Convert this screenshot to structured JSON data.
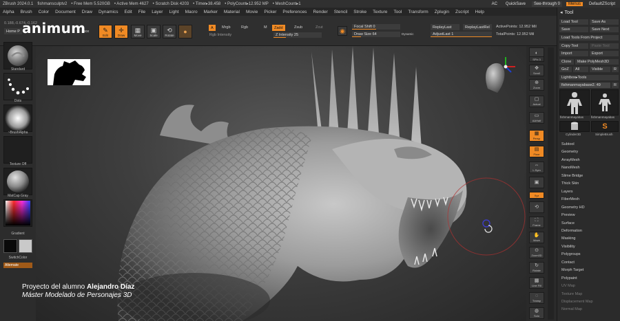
{
  "titlebar": {
    "app_version": "ZBrush 2024.0.1",
    "project": "fishmansculptv2",
    "free_mem": "• Free Mem 5.520GB",
    "active_mem": "• Active Mem 4627",
    "scratch_disk": "• Scratch Disk 4203",
    "timer": "• Timer▸38.458",
    "poly_count": "• PolyCount▸12.952 MP",
    "mesh_count": "• MeshCount▸1",
    "ac": "AC",
    "quicksave": "QuickSave",
    "see_through": "See-through  0",
    "menus": "Menus",
    "default_script": "DefaultZScript"
  },
  "menubar": [
    "Alpha",
    "Brush",
    "Color",
    "Document",
    "Draw",
    "Dynamics",
    "Edit",
    "File",
    "Layer",
    "Light",
    "Macro",
    "Marker",
    "Material",
    "Movie",
    "Picker",
    "Preferences",
    "Render",
    "Stencil",
    "Stroke",
    "Texture",
    "Tool",
    "Transform",
    "Zplugin",
    "Zscript",
    "Help"
  ],
  "topshelf": {
    "home": "Home P",
    "lightbox_partial": "tbox",
    "coord": "0.188,-0.674,-0.162",
    "edit": "Edit",
    "draw": "Draw",
    "move": "Move",
    "scale": "Scale",
    "rotate": "Rotate",
    "a": "A",
    "mrgb": "Mrgb",
    "rgb": "Rgb",
    "m": "M",
    "rgb_intensity": "Rgb Intensity",
    "zadd": "Zadd",
    "zsub": "Zsub",
    "zcut": "Zcut",
    "z_intensity": "Z Intensity 25",
    "focal_shift": "Focal Shift 0",
    "draw_size": "Draw Size 64",
    "dynamic": "Dynamic",
    "replay_last": "ReplayLast",
    "replay_last_rel": "ReplayLastRel",
    "adjust_last": "AdjustLast 1",
    "active_points": "ActivePoints: 12.952 Mil",
    "total_points": "TotalPoints: 12.952 Mil"
  },
  "leftshelf": {
    "brush": "Standard",
    "stroke": "Dots",
    "alpha": "~BrushAlpha",
    "texture": "Texture Off",
    "material": "MatCap Gray",
    "gradient": "Gradient",
    "switch_color": "SwitchColor",
    "alternate": "Alternate"
  },
  "righttools": {
    "spix": "SPix 3",
    "scroll": "Scroll",
    "zoom": "Zoom",
    "actual": "Actual",
    "aahalf": "AAHalf",
    "persp": "Persp",
    "floor": "Floor",
    "l_sym": "L.Sym",
    "xyz": "Xyz",
    "frame": "Frame",
    "move": "Move",
    "zoom3d": "Zoom3D",
    "rotate": "Rotate",
    "line_fill": "Line Fill",
    "polyf": "PolyF",
    "transp": "Transp",
    "solo": "Solo"
  },
  "toolpanel": {
    "title": "Tool",
    "load_tool": "Load Tool",
    "save_as": "Save As",
    "save": "Save",
    "save_next": "Save Next",
    "load_from_project": "Load Tools From Project",
    "copy_tool": "Copy Tool",
    "paste_tool": "Paste Tool",
    "import": "Import",
    "export": "Export",
    "clone": "Clone",
    "make_polymesh": "Make PolyMesh3D",
    "goz": "GoZ",
    "all": "All",
    "visible": "Visible",
    "r": "R",
    "lightbox_tools": "Lightbox▸Tools",
    "current_tool": "fishmanmayabase2. 49",
    "r2": "R",
    "thumb1": "fishmanmayabas",
    "thumb2": "fishmanmayabas",
    "thumb3": "Cylinder3D",
    "thumb4": "SimpleBrush",
    "sections": [
      "Subtool",
      "Geometry",
      "ArrayMesh",
      "NanoMesh",
      "Slime Bridge",
      "Thick Skin",
      "Layers",
      "FiberMesh",
      "Geometry HD",
      "Preview",
      "Surface",
      "Deformation",
      "Masking",
      "Visibility",
      "Polygroups",
      "Contact",
      "Morph Target",
      "Polypaint",
      "UV Map",
      "Texture Map",
      "Displacement Map",
      "Normal Map"
    ]
  },
  "overlay": {
    "brand": "animum",
    "credit_prefix": "Proyecto del alumno ",
    "credit_name": "Alejandro Díaz",
    "course": "Máster Modelado de Personajes 3D"
  }
}
